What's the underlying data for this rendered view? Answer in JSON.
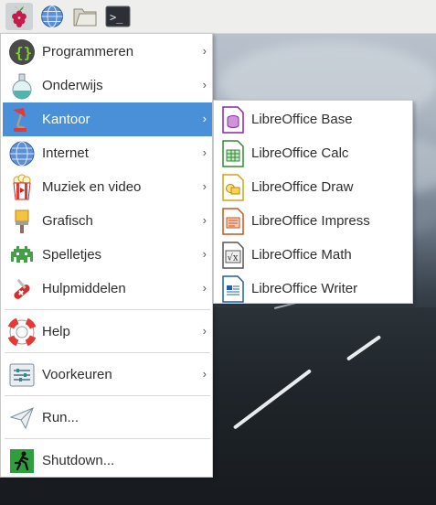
{
  "panel": {
    "icons": [
      "raspberry-pi-menu-icon",
      "web-browser-icon",
      "file-manager-icon",
      "terminal-icon"
    ]
  },
  "menu": {
    "items": [
      {
        "label": "Programmeren",
        "icon": "code-braces-icon",
        "has_submenu": true
      },
      {
        "label": "Onderwijs",
        "icon": "flask-icon",
        "has_submenu": true
      },
      {
        "label": "Kantoor",
        "icon": "desk-lamp-icon",
        "has_submenu": true,
        "active": true
      },
      {
        "label": "Internet",
        "icon": "globe-icon",
        "has_submenu": true
      },
      {
        "label": "Muziek en video",
        "icon": "popcorn-icon",
        "has_submenu": true
      },
      {
        "label": "Grafisch",
        "icon": "paintbrush-icon",
        "has_submenu": true
      },
      {
        "label": "Spelletjes",
        "icon": "space-invader-icon",
        "has_submenu": true
      },
      {
        "label": "Hulpmiddelen",
        "icon": "pocket-knife-icon",
        "has_submenu": true
      },
      {
        "label": "Help",
        "icon": "lifebuoy-icon",
        "has_submenu": true
      },
      {
        "label": "Voorkeuren",
        "icon": "sliders-icon",
        "has_submenu": true
      },
      {
        "label": "Run...",
        "icon": "paper-plane-icon",
        "has_submenu": false
      },
      {
        "label": "Shutdown...",
        "icon": "exit-running-man-icon",
        "has_submenu": false
      }
    ],
    "arrow": "›"
  },
  "submenu": {
    "items": [
      {
        "label": "LibreOffice Base",
        "icon": "libreoffice-base-icon",
        "color": "#8e24aa"
      },
      {
        "label": "LibreOffice Calc",
        "icon": "libreoffice-calc-icon",
        "color": "#2e8b2e"
      },
      {
        "label": "LibreOffice Draw",
        "icon": "libreoffice-draw-icon",
        "color": "#d4a017"
      },
      {
        "label": "LibreOffice Impress",
        "icon": "libreoffice-impress-icon",
        "color": "#c0561c"
      },
      {
        "label": "LibreOffice Math",
        "icon": "libreoffice-math-icon",
        "color": "#555555"
      },
      {
        "label": "LibreOffice Writer",
        "icon": "libreoffice-writer-icon",
        "color": "#1f5fa8"
      }
    ]
  },
  "colors": {
    "highlight": "#4a90d9",
    "panel": "#eeeeec"
  }
}
